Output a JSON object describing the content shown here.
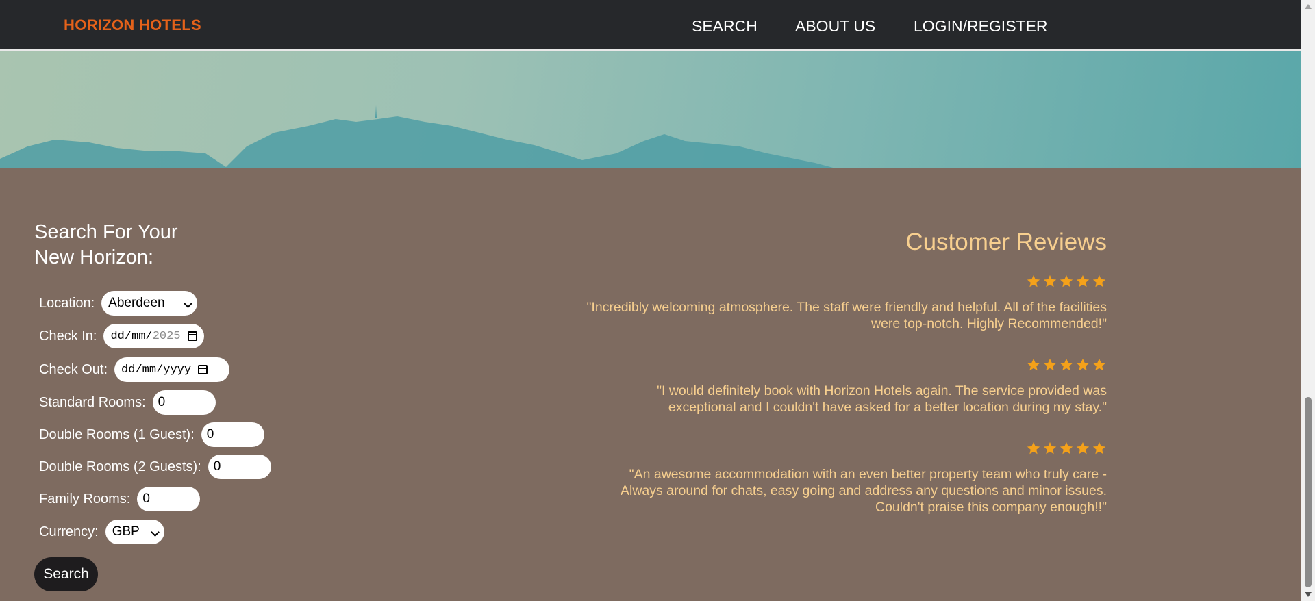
{
  "navbar": {
    "brand": "HORIZON HOTELS",
    "links": [
      "SEARCH",
      "ABOUT US",
      "LOGIN/REGISTER"
    ]
  },
  "search": {
    "title_line1": "Search For Your",
    "title_line2": "New Horizon:",
    "location_label": "Location:",
    "location_value": "Aberdeen",
    "checkin_label": "Check In:",
    "checkin_value": "dd/mm/",
    "checkin_year": "2025",
    "checkout_label": "Check Out:",
    "checkout_value": "dd/mm/yyyy",
    "standard_label": "Standard Rooms:",
    "standard_value": "0",
    "double1_label": "Double Rooms (1 Guest):",
    "double1_value": "0",
    "double2_label": "Double Rooms (2 Guests):",
    "double2_value": "0",
    "family_label": "Family Rooms:",
    "family_value": "0",
    "currency_label": "Currency:",
    "currency_value": "GBP",
    "button": "Search"
  },
  "reviews": {
    "title": "Customer Reviews",
    "items": [
      {
        "rating": 5,
        "text": "\"Incredibly welcoming atmosphere. The staff were friendly and helpful. All of the facilities were top-notch. Highly Recommended!\""
      },
      {
        "rating": 5,
        "text": "\"I would definitely book with Horizon Hotels again. The service provided was exceptional and I couldn't have asked for a better location during my stay.\""
      },
      {
        "rating": 5,
        "text": "\"An awesome accommodation with an even better property team who truly care - Always around for chats, easy going and address any questions and minor issues. Couldn't praise this company enough!!\""
      }
    ]
  },
  "colors": {
    "navbar_bg": "#26282b",
    "brand": "#e5621a",
    "content_bg": "#7e6b60",
    "review_text": "#f7cf8f",
    "star": "#f4a11a"
  },
  "icons": {
    "star": "star-icon",
    "calendar": "calendar-icon",
    "dropdown": "chevron-down-icon"
  }
}
